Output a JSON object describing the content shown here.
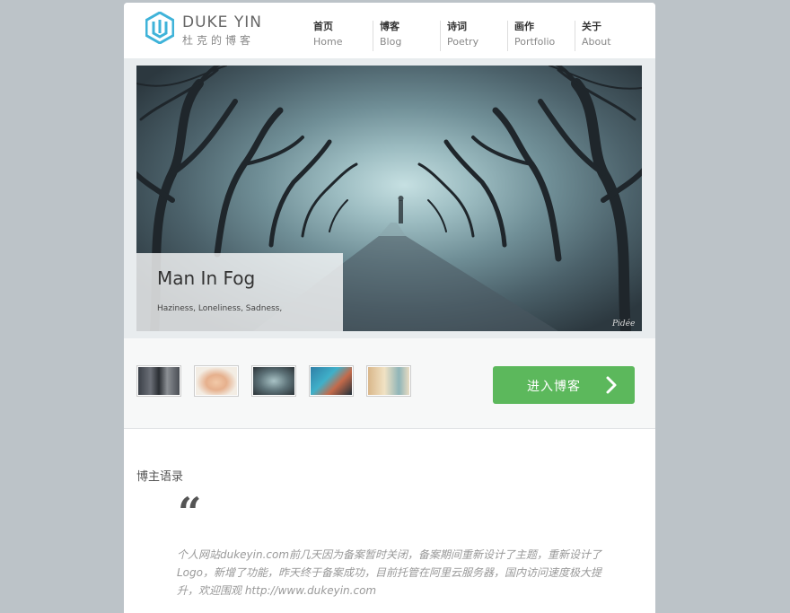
{
  "brand": {
    "name_en": "DUKE YIN",
    "name_cn": "杜克的博客",
    "accent_color": "#3fb3d9"
  },
  "nav": [
    {
      "cn": "首页",
      "en": "Home"
    },
    {
      "cn": "博客",
      "en": "Blog"
    },
    {
      "cn": "诗词",
      "en": "Poetry"
    },
    {
      "cn": "画作",
      "en": "Portfolio"
    },
    {
      "cn": "关于",
      "en": "About"
    }
  ],
  "hero": {
    "title": "Man In Fog",
    "tags": "Haziness, Loneliness, Sadness,"
  },
  "thumbnails": [
    "thumb-street-person",
    "thumb-portrait-face",
    "thumb-fog-trees",
    "thumb-blue-hair-girl",
    "thumb-reading-window"
  ],
  "enter_button": {
    "label": "进入博客",
    "color": "#5cb85c",
    "icon": "chevron-right-icon"
  },
  "quote_section": {
    "title": "博主语录",
    "quote_mark": "“",
    "text": "个人网站dukeyin.com前几天因为备案暂时关闭，备案期间重新设计了主题，重新设计了Logo，新增了功能，昨天终于备案成功，目前托管在阿里云服务器，国内访问速度极大提升，欢迎围观 http://www.dukeyin.com"
  }
}
